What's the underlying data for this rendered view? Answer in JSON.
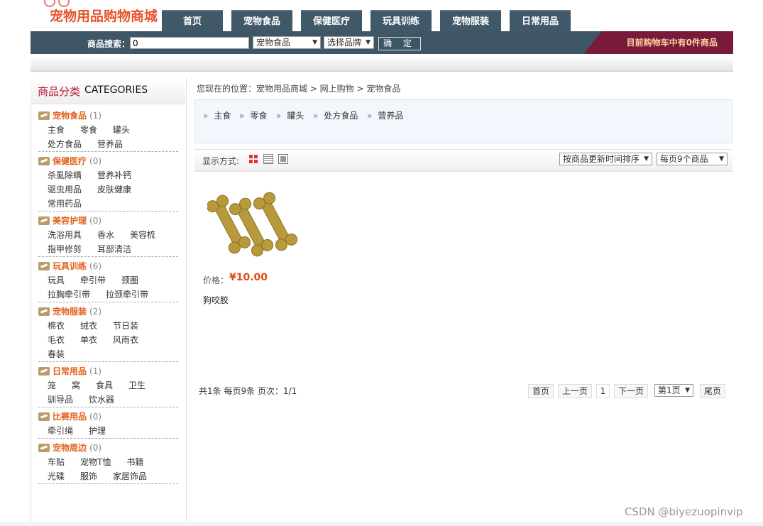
{
  "header": {
    "logo_text": "宠物用品购物商城",
    "nav": [
      "首页",
      "宠物食品",
      "保健医疗",
      "玩具训练",
      "宠物服装",
      "日常用品"
    ],
    "search": {
      "label": "商品搜索：",
      "value": "0",
      "category_selected": "宠物食品",
      "brand_selected": "选择品牌",
      "submit_label": "确 定"
    },
    "cart_text": "目前购物车中有0件商品"
  },
  "sidebar": {
    "title_cn": "商品分类",
    "title_en": "CATEGORIES",
    "categories": [
      {
        "name": "宠物食品",
        "count": "(1)",
        "items": [
          "主食",
          "零食",
          "罐头",
          "处方食品",
          "营养品"
        ]
      },
      {
        "name": "保健医疗",
        "count": "(0)",
        "items": [
          "杀虱除螨",
          "营养补钙",
          "驱虫用品",
          "皮肤健康",
          "常用药品"
        ]
      },
      {
        "name": "美容护理",
        "count": "(0)",
        "items": [
          "洗浴用具",
          "香水",
          "美容梳",
          "指甲修剪",
          "耳部清洁"
        ]
      },
      {
        "name": "玩具训练",
        "count": "(6)",
        "items": [
          "玩具",
          "牵引带",
          "颈圈",
          "拉胸牵引带",
          "拉颈牵引带"
        ]
      },
      {
        "name": "宠物服装",
        "count": "(2)",
        "items": [
          "棉衣",
          "绒衣",
          "节日装",
          "毛衣",
          "单衣",
          "风雨衣",
          "春装"
        ]
      },
      {
        "name": "日常用品",
        "count": "(1)",
        "items": [
          "笼",
          "窝",
          "食具",
          "卫生",
          "驯导品",
          "饮水器"
        ]
      },
      {
        "name": "比赛用品",
        "count": "(0)",
        "items": [
          "牵引绳",
          "护理"
        ]
      },
      {
        "name": "宠物周边",
        "count": "(0)",
        "items": [
          "车贴",
          "宠物T恤",
          "书籍",
          "光碟",
          "服饰",
          "家居饰品"
        ]
      }
    ]
  },
  "main": {
    "breadcrumb": "您现在的位置：宠物用品商城 > 网上购物 > 宠物食品",
    "subcategories": [
      "主食",
      "零食",
      "罐头",
      "处方食品",
      "营养品"
    ],
    "display_label": "显示方式:",
    "sort_selected": "按商品更新时间排序",
    "per_page_selected": "每页9个商品",
    "products": [
      {
        "price_label": "价格：",
        "price": "¥10.00",
        "name": "狗咬胶"
      }
    ],
    "pager": {
      "info": "共1条 每页9条 页次：1/1",
      "first": "首页",
      "prev": "上一页",
      "current": "1",
      "next": "下一页",
      "page_select": "第1页",
      "last": "尾页"
    }
  },
  "watermark": "CSDN @biyezuopinvip",
  "colors": {
    "nav_bg": "#405868",
    "accent": "#e2621c",
    "price": "#e2491b",
    "cart_bg": "#7a1a3a"
  },
  "icons": [
    "grid-view-icon",
    "list-view-icon",
    "large-view-icon",
    "category-bone-icon",
    "dropdown-arrow-icon"
  ]
}
